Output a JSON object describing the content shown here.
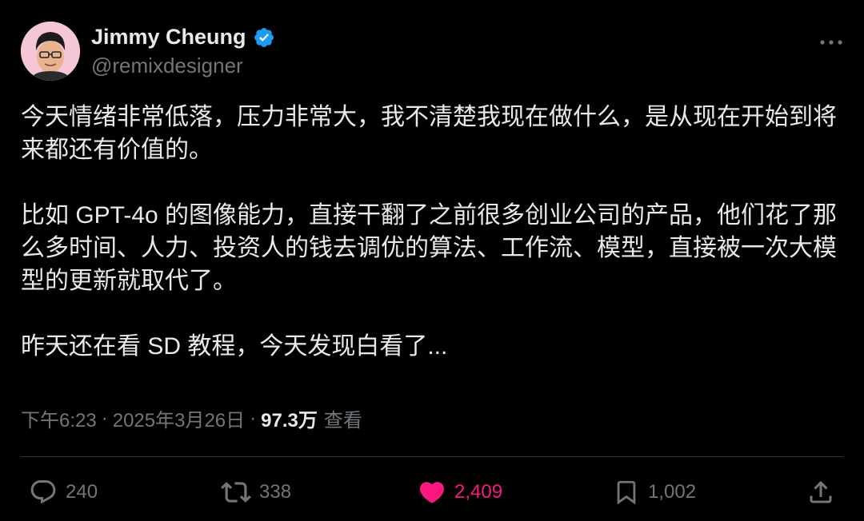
{
  "author": {
    "name": "Jimmy Cheung",
    "handle": "@remixdesigner"
  },
  "tweet": {
    "paragraphs": [
      "今天情绪非常低落，压力非常大，我不清楚我现在做什么，是从现在开始到将来都还有价值的。",
      "比如 GPT-4o 的图像能力，直接干翻了之前很多创业公司的产品，他们花了那么多时间、人力、投资人的钱去调优的算法、工作流、模型，直接被一次大模型的更新就取代了。",
      "昨天还在看 SD 教程，今天发现白看了..."
    ],
    "time": "下午6:23",
    "separator": "·",
    "date": "2025年3月26日",
    "views_count": "97.3万",
    "views_label": "查看"
  },
  "actions": {
    "replies": "240",
    "retweets": "338",
    "likes": "2,409",
    "bookmarks": "1,002"
  },
  "colors": {
    "background": "#000000",
    "text": "#e7e9ea",
    "muted": "#71767b",
    "like": "#f91880",
    "verified": "#1d9bf0"
  }
}
